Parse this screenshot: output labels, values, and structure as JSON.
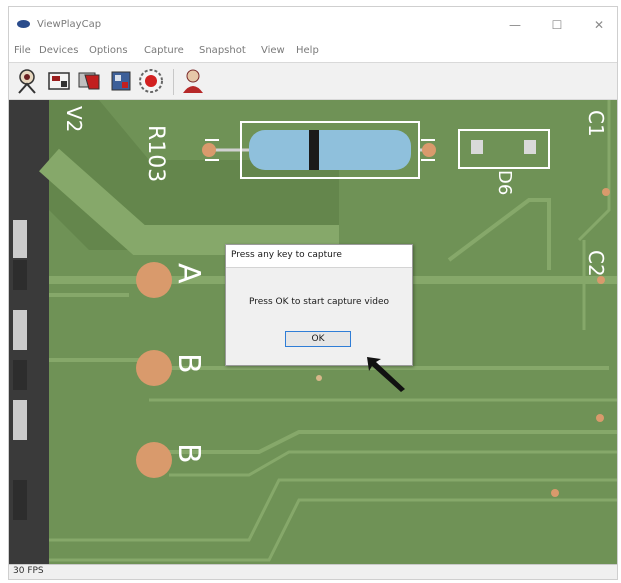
{
  "window": {
    "title": "ViewPlayCap",
    "icon": "eye-icon",
    "controls": {
      "minimize": "—",
      "maximize": "☐",
      "close": "✕"
    }
  },
  "menu": [
    "File",
    "Devices",
    "Options",
    "Capture",
    "Snapshot",
    "View",
    "Help"
  ],
  "toolbar": {
    "buttons": [
      "camera-icon",
      "display-icon",
      "flip-icon",
      "card-icon",
      "record-icon",
      "user-icon"
    ]
  },
  "board": {
    "silkscreen": {
      "r103": "R103",
      "d6": "D6",
      "c1": "C1",
      "c2": "C2",
      "v2": "V2",
      "pad_a": "A",
      "pad_b": "B",
      "pad_b2": "B"
    }
  },
  "dialog": {
    "title": "Press any key to capture",
    "message": "Press OK to start capture video",
    "ok_label": "OK"
  },
  "status": {
    "text": "30 FPS"
  },
  "colors": {
    "pcb": "#6f9256",
    "trace": "#86a86a",
    "copper": "#d99a6c",
    "accent": "#2f7dd6"
  }
}
